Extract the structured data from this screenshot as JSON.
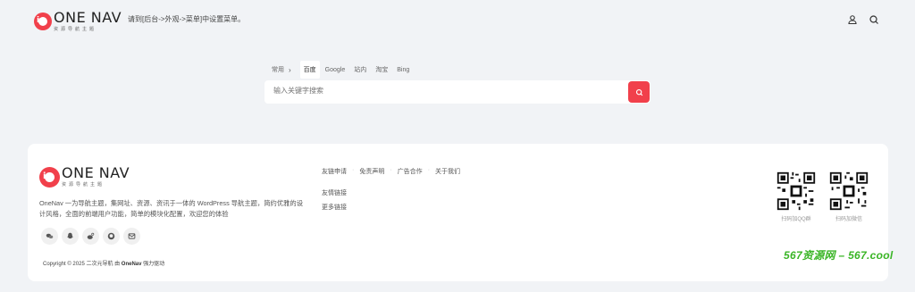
{
  "header": {
    "logo_title": "ONE NAV",
    "logo_sub": "资源导航主题",
    "menu_tip": "请到[后台->外观->菜单]中设置菜单。",
    "icons": [
      "user-icon",
      "search-icon"
    ]
  },
  "search": {
    "group_label": "常用",
    "tabs": [
      {
        "label": "百度",
        "active": true
      },
      {
        "label": "Google",
        "active": false
      },
      {
        "label": "站内",
        "active": false
      },
      {
        "label": "淘宝",
        "active": false
      },
      {
        "label": "Bing",
        "active": false
      }
    ],
    "placeholder": "输入关键字搜索",
    "accent": "#f1404b"
  },
  "footer": {
    "logo_title": "ONE NAV",
    "logo_sub": "资源导航主题",
    "about": "OneNav 一为导航主题，集网址、资源、资讯于一体的 WordPress 导航主题，简约优雅的设计风格，全面的前端用户功能，简单的模块化配置，欢迎您的体验",
    "socials": [
      "wechat-icon",
      "qq-icon",
      "weibo-icon",
      "github-icon",
      "email-icon"
    ],
    "links": [
      "友链申请",
      "免责声明",
      "广告合作",
      "关于我们"
    ],
    "friend_links_title": "友情链接",
    "more_links": "更多链接",
    "qr_codes": [
      {
        "label": "扫码加QQ群"
      },
      {
        "label": "扫码加微信"
      }
    ],
    "copyright_prefix": "Copyright © 2025 二次元导航 由 ",
    "copyright_brand": "OneNav",
    "copyright_suffix": " 强力驱动"
  },
  "watermark": "567资源网 – 567.cool"
}
